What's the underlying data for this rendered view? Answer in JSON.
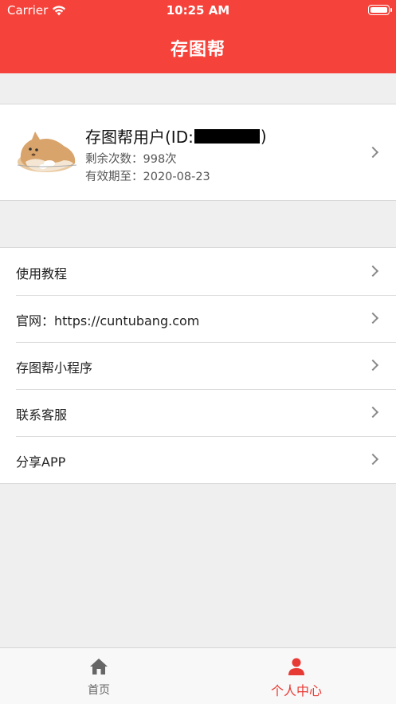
{
  "status_bar": {
    "carrier": "Carrier",
    "time": "10:25 AM"
  },
  "header": {
    "title": "存图帮"
  },
  "profile": {
    "name_prefix": "存图帮用户(ID:",
    "name_suffix": ")",
    "remaining": "剩余次数：998次",
    "expiry": "有效期至：2020-08-23"
  },
  "menu": {
    "items": [
      {
        "label": "使用教程"
      },
      {
        "label": "官网：https://cuntubang.com"
      },
      {
        "label": "存图帮小程序"
      },
      {
        "label": "联系客服"
      },
      {
        "label": "分享APP"
      }
    ]
  },
  "tabbar": {
    "home": "首页",
    "me": "个人中心"
  },
  "colors": {
    "brand": "#f5433b",
    "active_tab": "#e83a34",
    "inactive_tab": "#666666"
  }
}
